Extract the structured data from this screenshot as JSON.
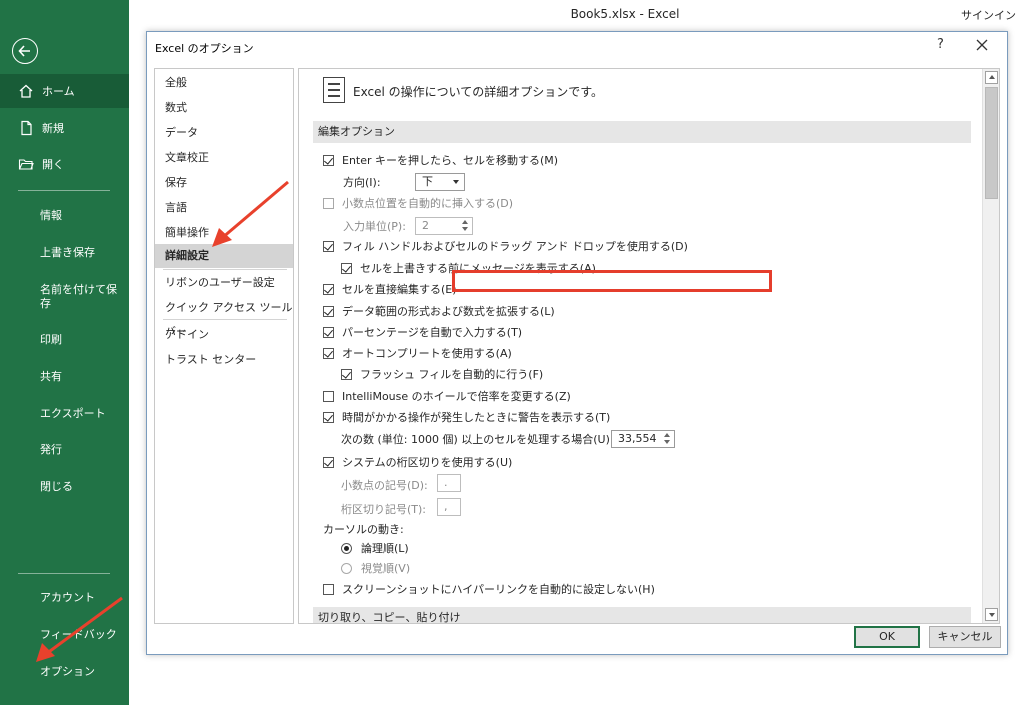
{
  "window": {
    "title": "Book5.xlsx  -  Excel",
    "signin": "サインイン"
  },
  "backstage": {
    "top_items": [
      {
        "label": "ホーム",
        "icon": "home-icon",
        "active": true
      },
      {
        "label": "新規",
        "icon": "new-document-icon"
      },
      {
        "label": "開く",
        "icon": "open-folder-icon"
      }
    ],
    "mid_items": [
      "情報",
      "上書き保存",
      "名前を付けて保存",
      "印刷",
      "共有",
      "エクスポート",
      "発行",
      "閉じる"
    ],
    "bottom_items": [
      "アカウント",
      "フィードバック",
      "オプション"
    ]
  },
  "dialog": {
    "title": "Excel のオプション",
    "help": "?",
    "nav": [
      "全般",
      "数式",
      "データ",
      "文章校正",
      "保存",
      "言語",
      "簡単操作",
      "詳細設定",
      "リボンのユーザー設定",
      "クイック アクセス ツール バー",
      "アドイン",
      "トラスト センター"
    ],
    "selected_nav": "詳細設定",
    "header": "Excel の操作についての詳細オプションです。",
    "section_editing": "編集オプション",
    "section_next": "切り取り、コピー、貼り付け",
    "options": {
      "enter_move": "Enter キーを押したら、セルを移動する(M)",
      "direction_label": "方向(I):",
      "direction_value": "下",
      "auto_decimal": "小数点位置を自動的に挿入する(D)",
      "places_label": "入力単位(P):",
      "places_value": "2",
      "fill_handle": "フィル ハンドルおよびセルのドラッグ アンド ドロップを使用する(D)",
      "alert_overwrite": "セルを上書きする前にメッセージを表示する(A)",
      "edit_directly": "セルを直接編集する(E)",
      "extend_formats": "データ範囲の形式および数式を拡張する(L)",
      "auto_percent": "パーセンテージを自動で入力する(T)",
      "autocomplete": "オートコンプリートを使用する(A)",
      "flash_fill": "フラッシュ フィルを自動的に行う(F)",
      "intellimouse": "IntelliMouse のホイールで倍率を変更する(Z)",
      "alert_slow": "時間がかかる操作が発生したときに警告を表示する(T)",
      "cells_label": "次の数 (単位: 1000 個) 以上のセルを処理する場合(U):",
      "cells_value": "33,554",
      "system_sep": "システムの桁区切りを使用する(U)",
      "decimal_sep_label": "小数点の記号(D):",
      "decimal_sep_value": ".",
      "thousands_sep_label": "桁区切り記号(T):",
      "thousands_sep_value": ",",
      "cursor_label": "カーソルの動き:",
      "logical": "論理順(L)",
      "visual": "視覚順(V)",
      "no_hyperlink": "スクリーンショットにハイパーリンクを自動的に設定しない(H)"
    },
    "ok": "OK",
    "cancel": "キャンセル"
  },
  "colors": {
    "excel_green": "#217346",
    "highlight_red": "#e53d2c",
    "arrow_red": "#e8412c"
  }
}
